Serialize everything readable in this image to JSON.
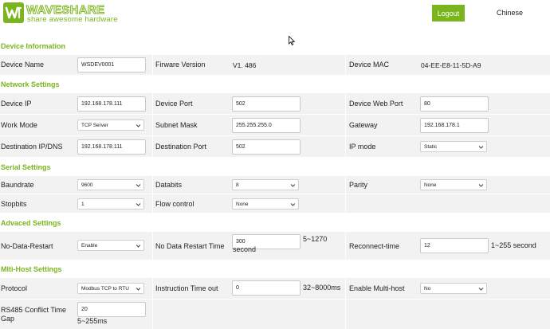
{
  "header": {
    "brand": "WAVESHARE",
    "tagline": "share awesome hardware",
    "logout_label": "Logout",
    "language_label": "Chinese",
    "accent_color": "#7ab51d"
  },
  "sections": {
    "device_info": "Device Information",
    "network": "Network Settings",
    "serial": "Serial Settings",
    "advanced": "Advaced Settings",
    "multihost": "Mlti-Host Settings"
  },
  "device_info": {
    "device_name_label": "Device Name",
    "device_name_value": "WSDEV0001",
    "firmware_label": "Firware Version",
    "firmware_value": "V1. 486",
    "mac_label": "Device MAC",
    "mac_value": "04-EE-E8-11-5D-A9"
  },
  "network": {
    "device_ip_label": "Device IP",
    "device_ip_value": "192.168.178.111",
    "device_port_label": "Device Port",
    "device_port_value": "502",
    "web_port_label": "Device Web Port",
    "web_port_value": "80",
    "work_mode_label": "Work Mode",
    "work_mode_value": "TCP Server",
    "subnet_label": "Subnet Mask",
    "subnet_value": "255.255.255.0",
    "gateway_label": "Gateway",
    "gateway_value": "192.168.178.1",
    "dest_ip_label": "Destination IP/DNS",
    "dest_ip_value": "192.168.178.111",
    "dest_port_label": "Destination Port",
    "dest_port_value": "502",
    "ip_mode_label": "IP mode",
    "ip_mode_value": "Static"
  },
  "serial": {
    "baud_label": "Baundrate",
    "baud_value": "9600",
    "databits_label": "Databits",
    "databits_value": "8",
    "parity_label": "Parity",
    "parity_value": "None",
    "stopbits_label": "Stopbits",
    "stopbits_value": "1",
    "flow_label": "Flow control",
    "flow_value": "None"
  },
  "advanced": {
    "ndr_label": "No-Data-Restart",
    "ndr_value": "Enable",
    "ndr_time_label": "No Data Restart Time",
    "ndr_time_value": "300",
    "ndr_time_unit": "5~1270 second",
    "reconnect_label": "Reconnect-time",
    "reconnect_value": "12",
    "reconnect_unit": "1~255 second"
  },
  "multihost": {
    "protocol_label": "Protocol",
    "protocol_value": "Modbus TCP to RTU",
    "timeout_label": "Instruction Time out",
    "timeout_value": "0",
    "timeout_unit": "32~8000ms",
    "multihost_label": "Enable Multi-host",
    "multihost_value": "No",
    "rs485_label": "RS485 Conflict Time Gap",
    "rs485_value": "20",
    "rs485_unit": "5~255ms"
  }
}
